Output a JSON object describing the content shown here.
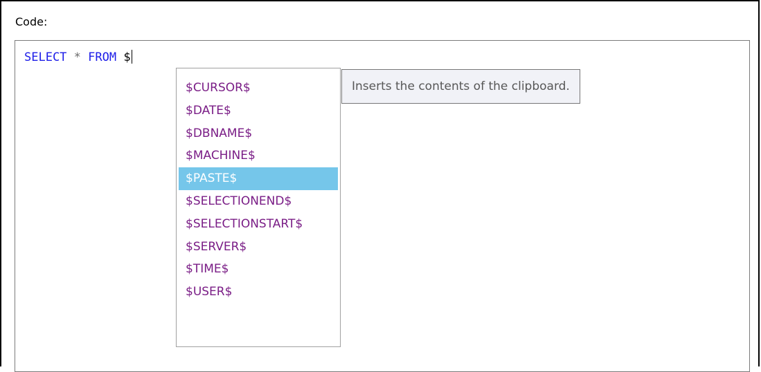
{
  "code_label": "Code:",
  "editor": {
    "keyword_select": "SELECT",
    "operator_star": "*",
    "keyword_from": "FROM",
    "typed_text": "$"
  },
  "completion": {
    "items": [
      {
        "label": "$CURSOR$",
        "selected": false
      },
      {
        "label": "$DATE$",
        "selected": false
      },
      {
        "label": "$DBNAME$",
        "selected": false
      },
      {
        "label": "$MACHINE$",
        "selected": false
      },
      {
        "label": "$PASTE$",
        "selected": true
      },
      {
        "label": "$SELECTIONEND$",
        "selected": false
      },
      {
        "label": "$SELECTIONSTART$",
        "selected": false
      },
      {
        "label": "$SERVER$",
        "selected": false
      },
      {
        "label": "$TIME$",
        "selected": false
      },
      {
        "label": "$USER$",
        "selected": false
      }
    ],
    "tooltip": "Inserts the contents of the clipboard."
  },
  "colors": {
    "keyword": "#1d1de8",
    "item_text": "#7a1d86",
    "selection": "#75c6ea",
    "tooltip_bg": "#f1f2f7"
  }
}
